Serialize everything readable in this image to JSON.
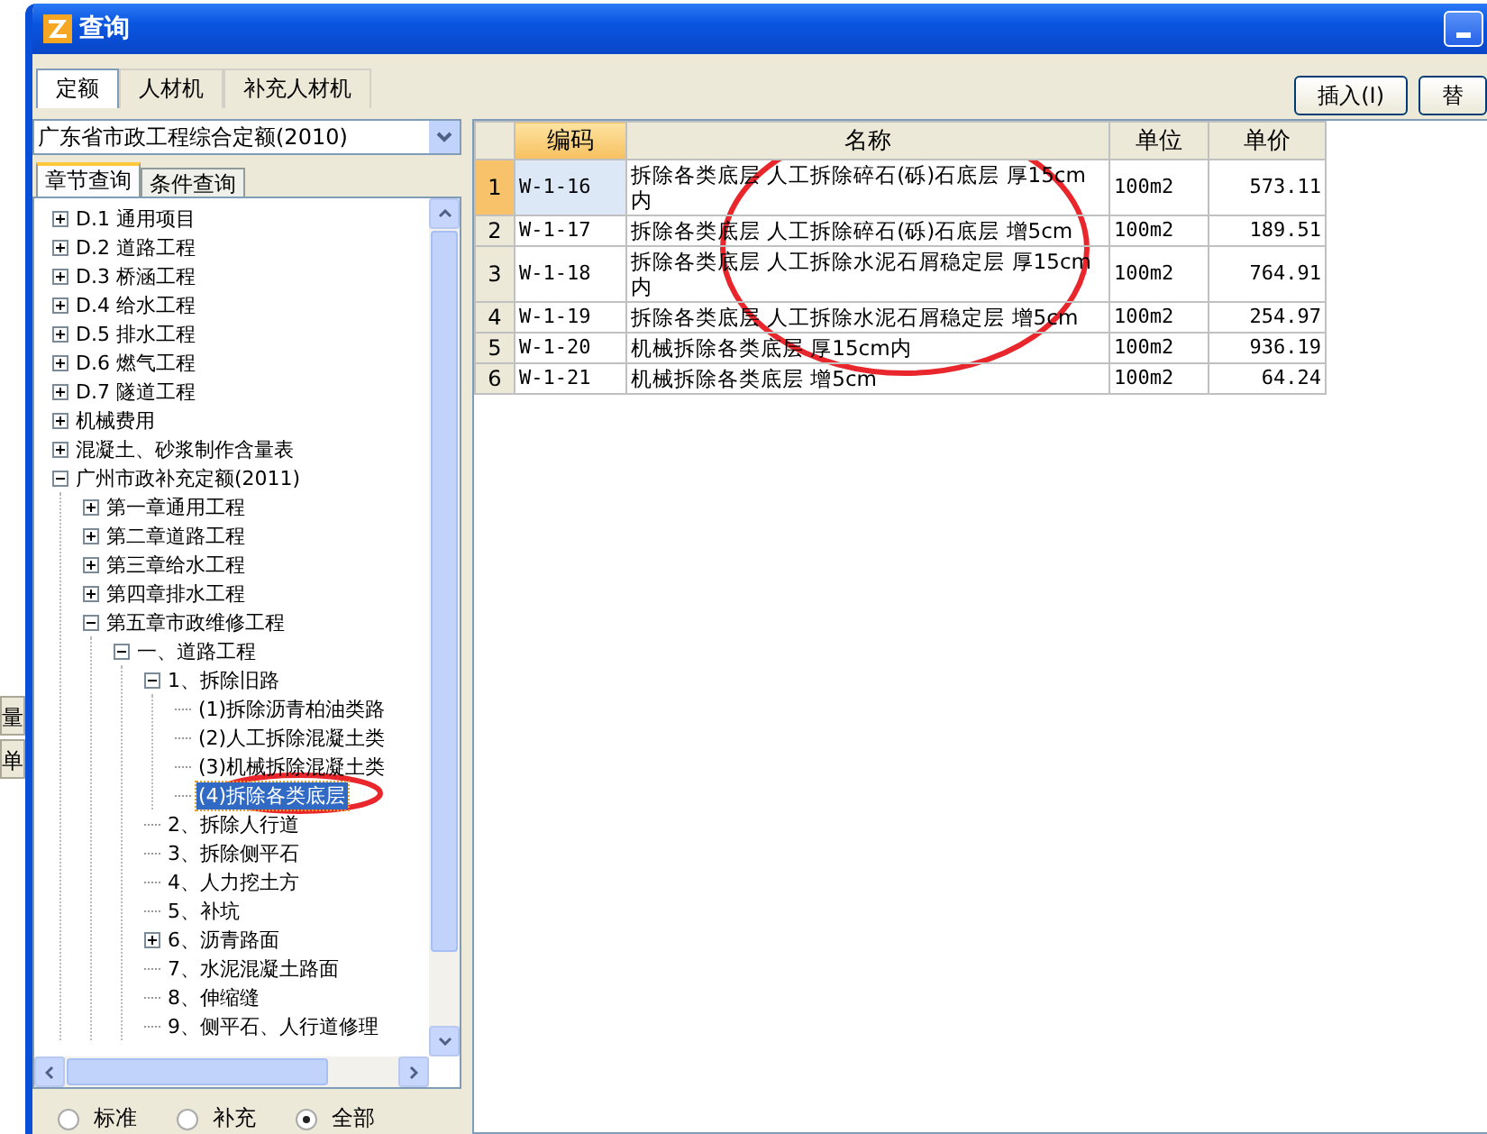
{
  "background_window": {
    "labels": [
      "量",
      "单"
    ]
  },
  "window": {
    "title": "查询"
  },
  "tabs": [
    {
      "label": "定额",
      "selected": true
    },
    {
      "label": "人材机",
      "selected": false
    },
    {
      "label": "补充人材机",
      "selected": false
    }
  ],
  "buttons": [
    "插入(I)",
    "替"
  ],
  "library_select": {
    "value": "广东省市政工程综合定额(2010)"
  },
  "sub_tabs": [
    {
      "label": "章节查询",
      "selected": true
    },
    {
      "label": "条件查询",
      "selected": false
    }
  ],
  "tree": [
    {
      "label": "D.1 通用项目",
      "expanded": false
    },
    {
      "label": "D.2 道路工程",
      "expanded": false
    },
    {
      "label": "D.3 桥涵工程",
      "expanded": false
    },
    {
      "label": "D.4 给水工程",
      "expanded": false
    },
    {
      "label": "D.5 排水工程",
      "expanded": false
    },
    {
      "label": "D.6 燃气工程",
      "expanded": false
    },
    {
      "label": "D.7 隧道工程",
      "expanded": false
    },
    {
      "label": "机械费用",
      "expanded": false
    },
    {
      "label": "混凝土、砂浆制作含量表",
      "expanded": false
    },
    {
      "label": "广州市政补充定额(2011)",
      "expanded": true,
      "children": [
        {
          "label": "第一章通用工程",
          "expanded": false
        },
        {
          "label": "第二章道路工程",
          "expanded": false
        },
        {
          "label": "第三章给水工程",
          "expanded": false
        },
        {
          "label": "第四章排水工程",
          "expanded": false
        },
        {
          "label": "第五章市政维修工程",
          "expanded": true,
          "children": [
            {
              "label": "一、道路工程",
              "expanded": true,
              "children": [
                {
                  "label": "1、拆除旧路",
                  "expanded": true,
                  "children": [
                    {
                      "label": "(1)拆除沥青柏油类路",
                      "selected": false
                    },
                    {
                      "label": "(2)人工拆除混凝土类",
                      "selected": false
                    },
                    {
                      "label": "(3)机械拆除混凝土类",
                      "selected": false
                    },
                    {
                      "label": "(4)拆除各类底层",
                      "selected": true
                    }
                  ]
                },
                {
                  "label": "2、拆除人行道",
                  "selected": false
                },
                {
                  "label": "3、拆除侧平石",
                  "selected": false
                },
                {
                  "label": "4、人力挖土方",
                  "selected": false
                },
                {
                  "label": "5、补坑",
                  "selected": false
                },
                {
                  "label": "6、沥青路面",
                  "expanded": false
                },
                {
                  "label": "7、水泥混凝土路面",
                  "selected": false
                },
                {
                  "label": "8、伸缩缝",
                  "selected": false
                },
                {
                  "label": "9、侧平石、人行道修理",
                  "selected": false
                }
              ]
            }
          ]
        }
      ]
    }
  ],
  "radios": [
    {
      "label": "标准",
      "selected": false
    },
    {
      "label": "补充",
      "selected": false
    },
    {
      "label": "全部",
      "selected": true
    }
  ],
  "table": {
    "columns": [
      "编码",
      "名称",
      "单位",
      "单价"
    ],
    "rows": [
      {
        "index": "1",
        "code": "W-1-16",
        "name": "拆除各类底层 人工拆除碎石(砾)石底层 厚15cm内",
        "unit": "100m2",
        "price": "573.11",
        "selected": true
      },
      {
        "index": "2",
        "code": "W-1-17",
        "name": "拆除各类底层 人工拆除碎石(砾)石底层 增5cm",
        "unit": "100m2",
        "price": "189.51",
        "selected": false
      },
      {
        "index": "3",
        "code": "W-1-18",
        "name": "拆除各类底层 人工拆除水泥石屑稳定层 厚15cm内",
        "unit": "100m2",
        "price": "764.91",
        "selected": false
      },
      {
        "index": "4",
        "code": "W-1-19",
        "name": "拆除各类底层 人工拆除水泥石屑稳定层 增5cm",
        "unit": "100m2",
        "price": "254.97",
        "selected": false
      },
      {
        "index": "5",
        "code": "W-1-20",
        "name": "机械拆除各类底层 厚15cm内",
        "unit": "100m2",
        "price": "936.19",
        "selected": false
      },
      {
        "index": "6",
        "code": "W-1-21",
        "name": "机械拆除各类底层 增5cm",
        "unit": "100m2",
        "price": "64.24",
        "selected": false
      }
    ]
  }
}
